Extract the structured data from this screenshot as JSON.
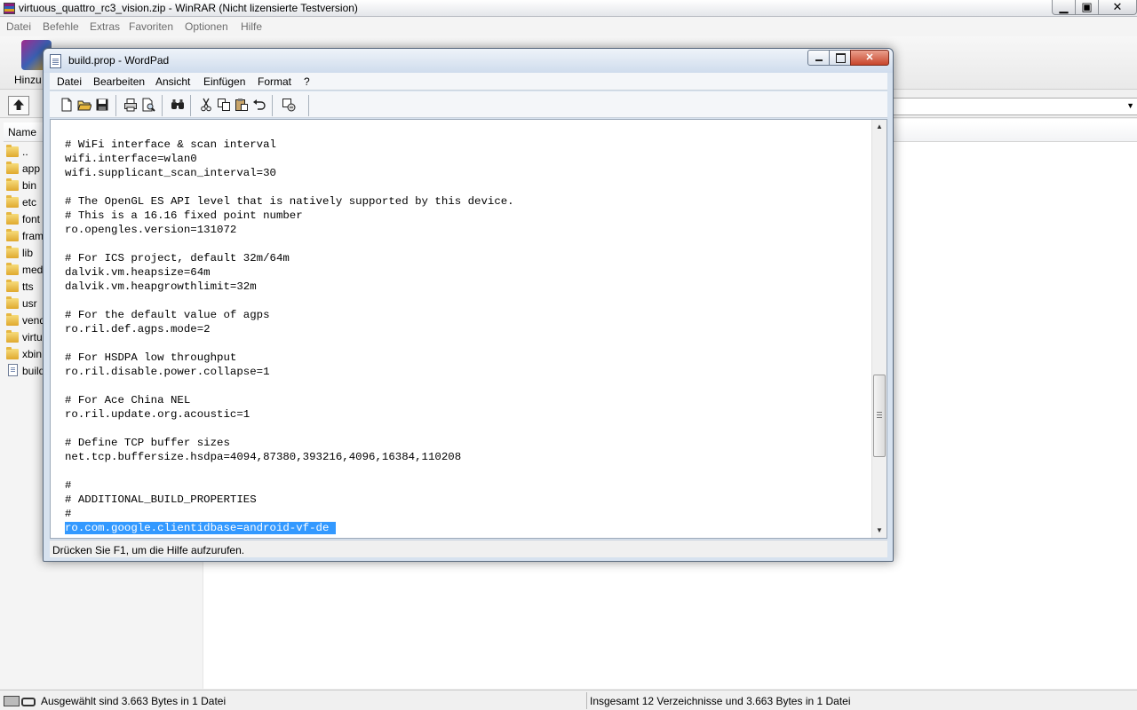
{
  "winrar": {
    "title": "virtuous_quattro_rc3_vision.zip - WinRAR (Nicht lizensierte Testversion)",
    "caption_buttons": {
      "minimize": "▁",
      "maximize": "▣",
      "close": "✕"
    },
    "menu": [
      "Datei",
      "Befehle",
      "Extras",
      "Favoriten",
      "Optionen",
      "Hilfe"
    ],
    "toolbar_add_label": "Hinzu",
    "column_name": "Name",
    "rows": [
      "..",
      "app",
      "bin",
      "etc",
      "font",
      "fram",
      "lib",
      "medi",
      "tts",
      "usr",
      "vend",
      "virtu",
      "xbin",
      "build"
    ],
    "status_left": "Ausgewählt sind 3.663 Bytes in 1 Datei",
    "status_right": "Insgesamt 12 Verzeichnisse und 3.663 Bytes in 1 Datei",
    "address_arrow": "▼"
  },
  "wordpad": {
    "title": "build.prop - WordPad",
    "menu": [
      "Datei",
      "Bearbeiten",
      "Ansicht",
      "Einfügen",
      "Format",
      "?"
    ],
    "toolbar_icons": [
      "new-icon",
      "open-icon",
      "save-icon",
      "print-icon",
      "print-preview-icon",
      "find-icon",
      "cut-icon",
      "copy-icon",
      "paste-icon",
      "undo-icon",
      "insert-object-icon"
    ],
    "lines": [
      "# WiFi interface & scan interval",
      "wifi.interface=wlan0",
      "wifi.supplicant_scan_interval=30",
      "",
      "# The OpenGL ES API level that is natively supported by this device.",
      "# This is a 16.16 fixed point number",
      "ro.opengles.version=131072",
      "",
      "# For ICS project, default 32m/64m",
      "dalvik.vm.heapsize=64m",
      "dalvik.vm.heapgrowthlimit=32m",
      "",
      "# For the default value of agps",
      "ro.ril.def.agps.mode=2",
      "",
      "# For HSDPA low throughput",
      "ro.ril.disable.power.collapse=1",
      "",
      "# For Ace China NEL",
      "ro.ril.update.org.acoustic=1",
      "",
      "# Define TCP buffer sizes",
      "net.tcp.buffersize.hsdpa=4094,87380,393216,4096,16384,110208",
      "",
      "#",
      "# ADDITIONAL_BUILD_PROPERTIES",
      "#"
    ],
    "selected_line": "ro.com.google.clientidbase=android-vf-de",
    "scroll_up_arrow": "▲",
    "scroll_down_arrow": "▼",
    "status": "Drücken Sie F1, um die Hilfe aufzurufen."
  },
  "colors": {
    "selection": "#3399ff",
    "wordpad_frame": "#d7e2ef",
    "close_button": "#c8452b"
  }
}
